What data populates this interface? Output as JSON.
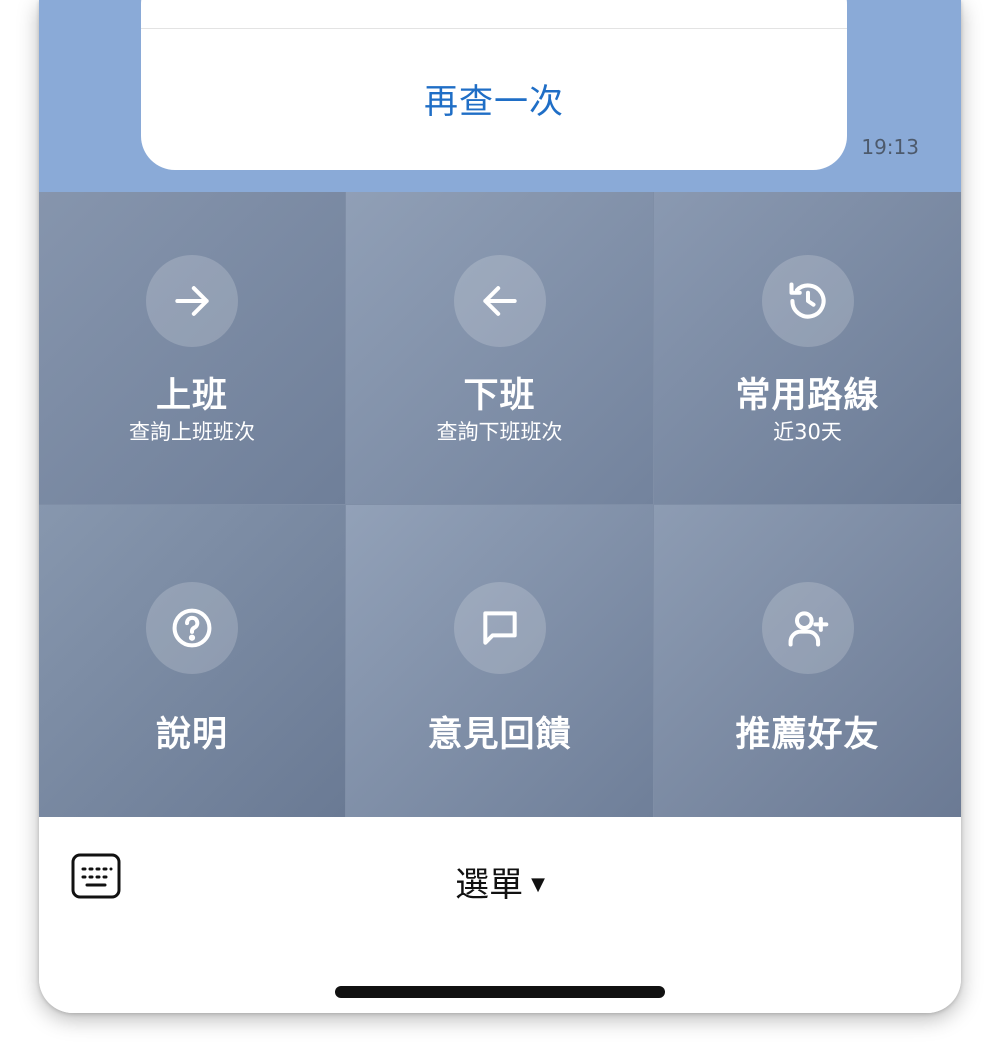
{
  "chat": {
    "bubble_action_label": "再查一次",
    "timestamp": "19:13"
  },
  "rich_menu": {
    "items": [
      {
        "title": "上班",
        "subtitle": "查詢上班班次",
        "icon": "arrow-right-icon"
      },
      {
        "title": "下班",
        "subtitle": "查詢下班班次",
        "icon": "arrow-left-icon"
      },
      {
        "title": "常用路線",
        "subtitle": "近30天",
        "icon": "history-icon"
      },
      {
        "title": "說明",
        "subtitle": "",
        "icon": "help-icon"
      },
      {
        "title": "意見回饋",
        "subtitle": "",
        "icon": "message-icon"
      },
      {
        "title": "推薦好友",
        "subtitle": "",
        "icon": "add-user-icon"
      }
    ]
  },
  "bottom_bar": {
    "menu_label": "選單",
    "menu_caret": "▼",
    "keyboard_icon": "keyboard-icon"
  },
  "colors": {
    "chat_background": "#8aaad7",
    "action_link": "#1f6ec6",
    "menu_tile": "#7f8ea6"
  }
}
